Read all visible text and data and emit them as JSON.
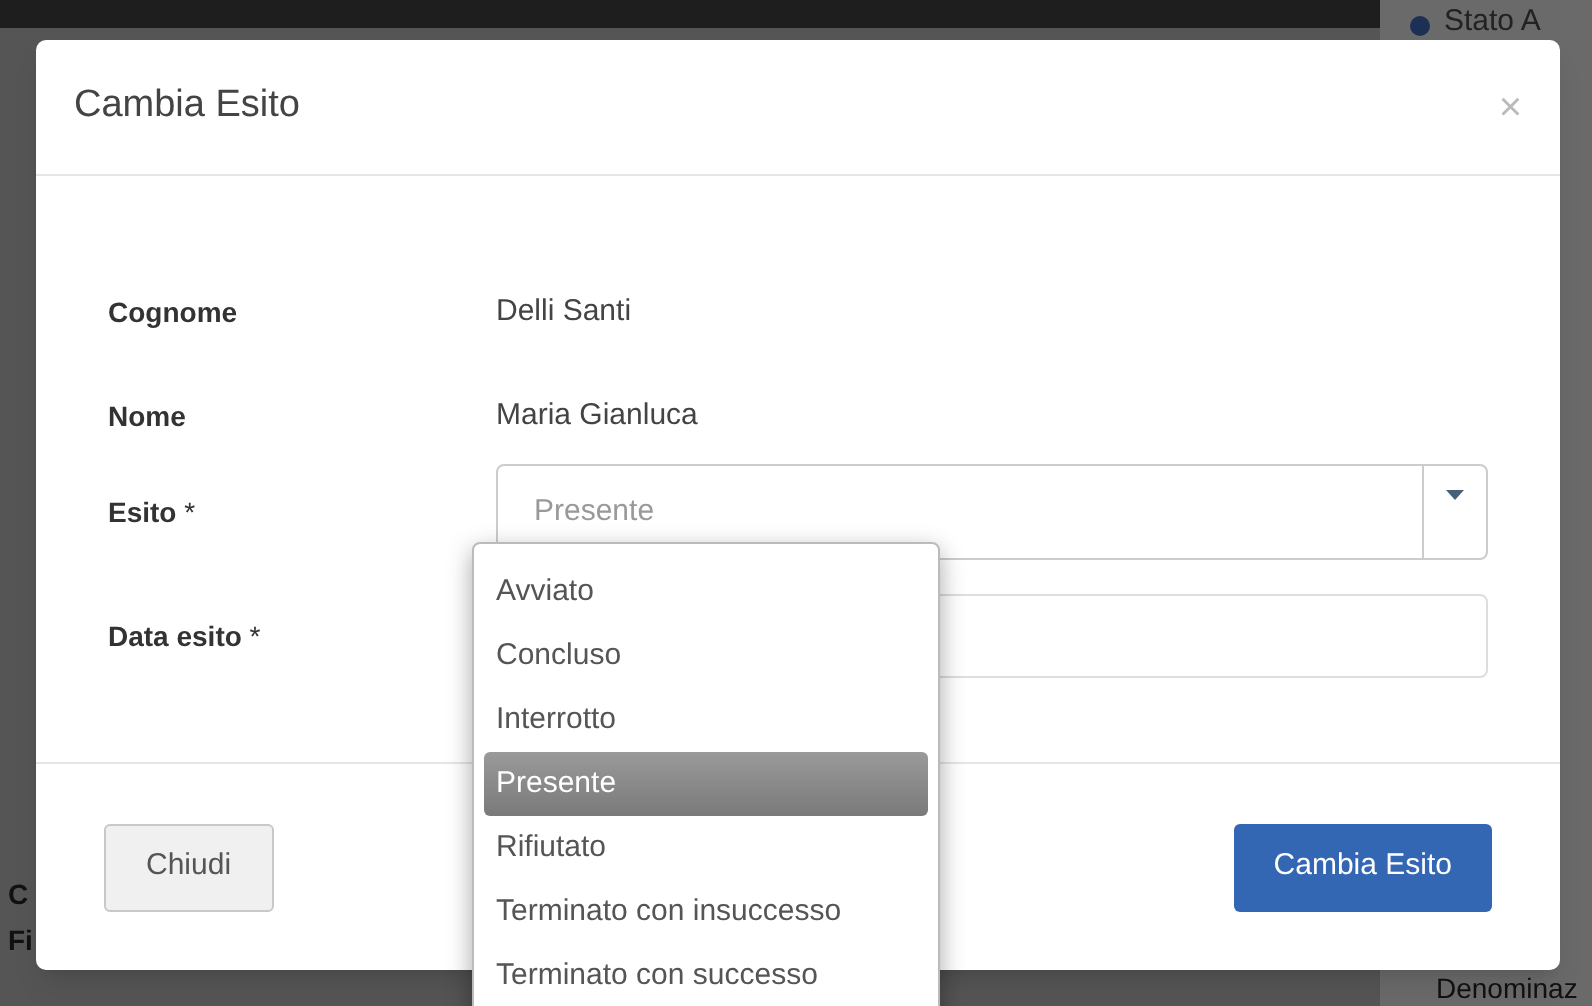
{
  "background": {
    "status_label": "Stato A",
    "row_labels": [
      "C",
      "Fi"
    ],
    "column_label": "Denominaz"
  },
  "dialog": {
    "title": "Cambia Esito",
    "close": "×",
    "fields": [
      {
        "kind": "text",
        "label": "Cognome",
        "value": "Delli Santi"
      },
      {
        "kind": "text",
        "label": "Nome",
        "value": "Maria Gianluca"
      },
      {
        "kind": "select",
        "label": "Esito",
        "required_mark": "*",
        "placeholder": "Presente",
        "expanded": true
      },
      {
        "kind": "input",
        "label": "Data esito",
        "required_mark": "*"
      }
    ],
    "options": [
      {
        "label": "Avviato",
        "selected": false
      },
      {
        "label": "Concluso",
        "selected": false
      },
      {
        "label": "Interrotto",
        "selected": false
      },
      {
        "label": "Presente",
        "selected": true
      },
      {
        "label": "Rifiutato",
        "selected": false
      },
      {
        "label": "Terminato con insuccesso",
        "selected": false
      },
      {
        "label": "Terminato con successo",
        "selected": false
      }
    ],
    "buttons": [
      {
        "kind": "secondary",
        "label": "Chiudi"
      },
      {
        "kind": "primary",
        "label": "Cambia Esito"
      }
    ]
  }
}
